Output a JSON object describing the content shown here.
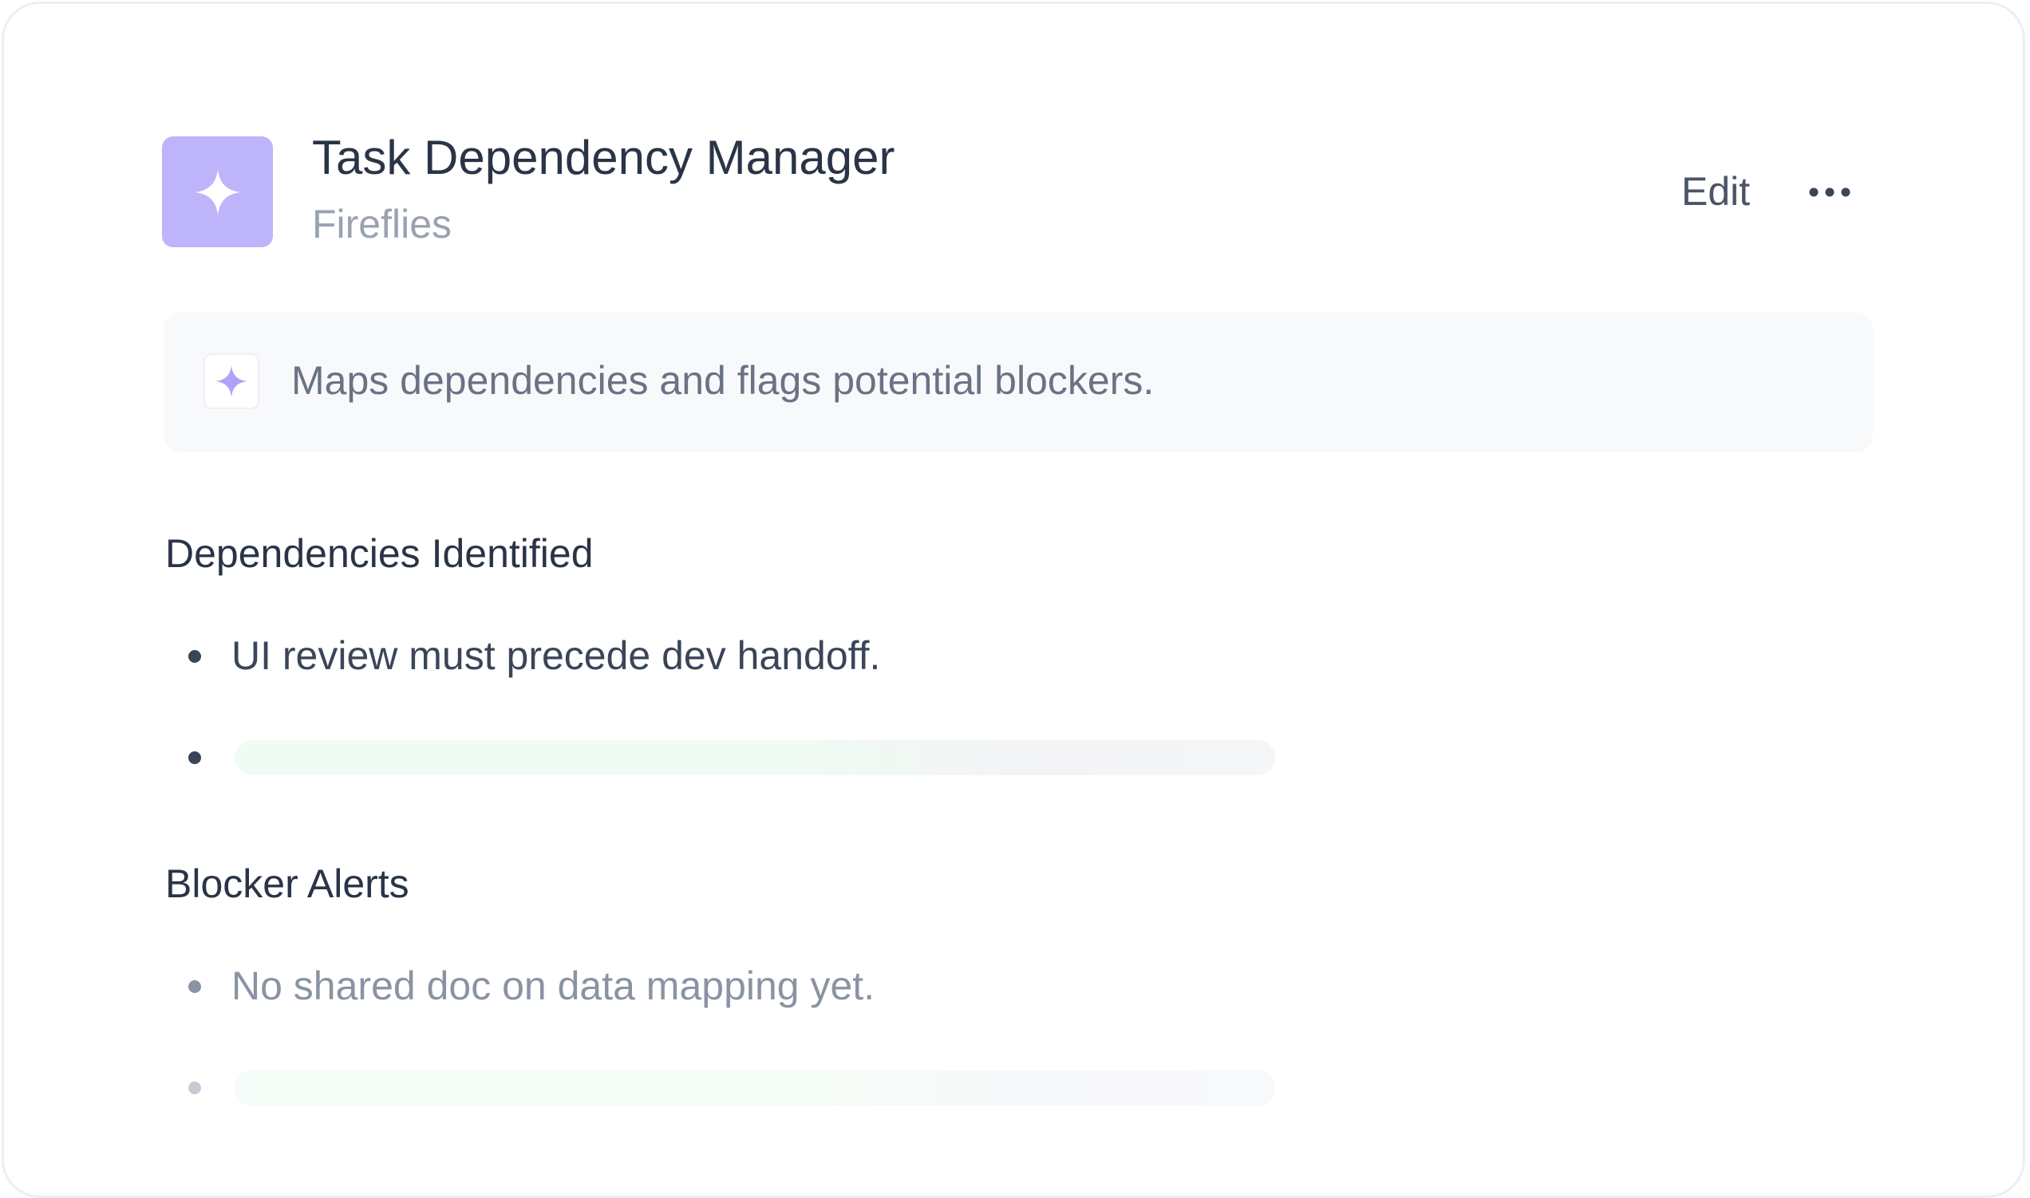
{
  "app": {
    "title": "Task Dependency Manager",
    "subtitle": "Fireflies",
    "icon": "sparkle-icon",
    "accent_color": "#bdb4fb"
  },
  "actions": {
    "edit_label": "Edit",
    "more_icon": "more-horizontal-icon"
  },
  "summary": {
    "icon": "sparkle-icon",
    "text": "Maps dependencies and flags potential blockers."
  },
  "sections": [
    {
      "heading": "Dependencies Identified",
      "items": [
        {
          "text": "UI review must precede dev handoff."
        },
        {
          "text": "",
          "loading": true
        }
      ]
    },
    {
      "heading": "Blocker Alerts",
      "items": [
        {
          "text": "No shared doc on data mapping yet."
        },
        {
          "text": "",
          "loading": true
        }
      ]
    }
  ]
}
